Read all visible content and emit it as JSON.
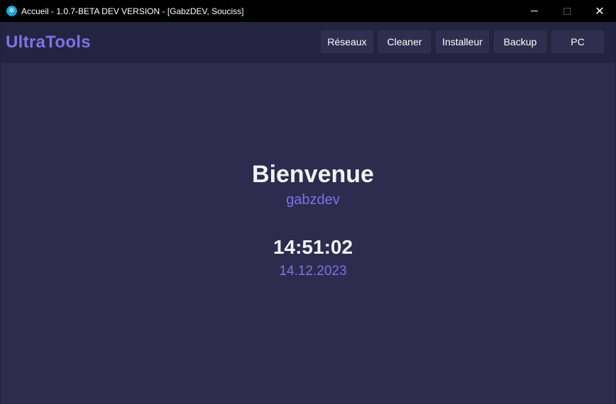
{
  "window": {
    "title": "Accueil - 1.0.7-BETA DEV VERSION - [GabzDEV, Souciss]",
    "app_icon_glyph": "✲",
    "close_glyph": "✕"
  },
  "header": {
    "logo": "UltraTools",
    "nav": [
      "Réseaux",
      "Cleaner",
      "Installeur",
      "Backup",
      "PC"
    ]
  },
  "main": {
    "welcome": "Bienvenue",
    "username": "gabzdev",
    "time": "14:51:02",
    "date": "14.12.2023"
  },
  "colors": {
    "accent": "#7b73e6",
    "background": "#2d2c4f",
    "topbar": "#252440",
    "titlebar": "#000000"
  }
}
